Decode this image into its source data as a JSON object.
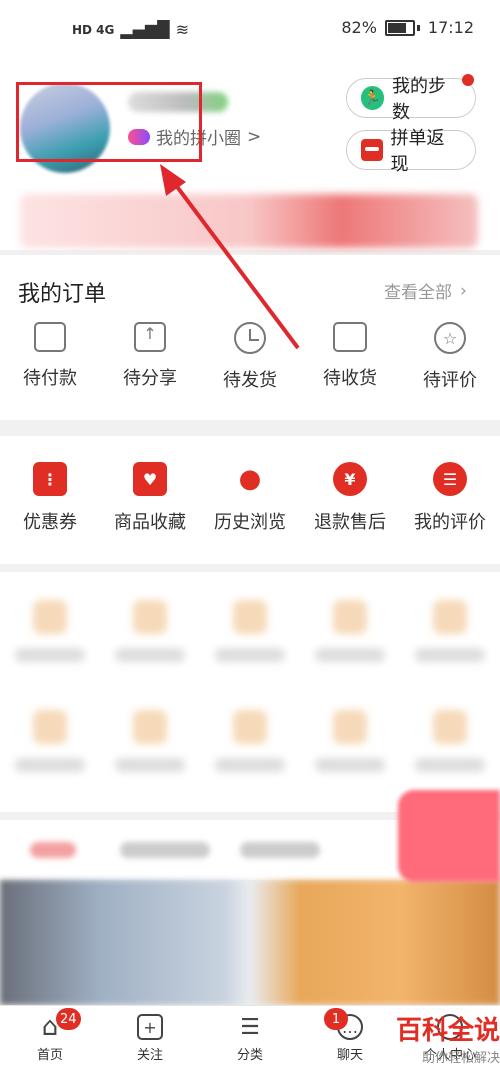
{
  "status_bar": {
    "left_icons": "HD 4G",
    "battery": "82%",
    "time": "17:12"
  },
  "profile": {
    "circle_link": "我的拼小圈",
    "chevron": ">"
  },
  "actions": {
    "steps": "我的步数",
    "cashback": "拼单返现"
  },
  "orders": {
    "title": "我的订单",
    "see_all": "查看全部",
    "items": [
      {
        "label": "待付款",
        "icon": "wallet-icon"
      },
      {
        "label": "待分享",
        "icon": "share-icon"
      },
      {
        "label": "待发货",
        "icon": "clock-icon"
      },
      {
        "label": "待收货",
        "icon": "truck-icon"
      },
      {
        "label": "待评价",
        "icon": "review-icon"
      }
    ]
  },
  "tools": {
    "items": [
      {
        "label": "优惠券",
        "icon": "coupon-icon",
        "glyph": "⋮"
      },
      {
        "label": "商品收藏",
        "icon": "bag-heart-icon",
        "glyph": "♥"
      },
      {
        "label": "历史浏览",
        "icon": "footprint-icon",
        "glyph": "●"
      },
      {
        "label": "退款售后",
        "icon": "yen-icon",
        "glyph": "¥"
      },
      {
        "label": "我的评价",
        "icon": "comment-list-icon",
        "glyph": "☰"
      }
    ]
  },
  "bottom_nav": {
    "items": [
      {
        "label": "首页",
        "icon": "home-icon",
        "glyph": "⌂",
        "badge": "24"
      },
      {
        "label": "关注",
        "icon": "plus-icon",
        "glyph": "+",
        "badge": ""
      },
      {
        "label": "分类",
        "icon": "menu-icon",
        "glyph": "☰",
        "badge": ""
      },
      {
        "label": "聊天",
        "icon": "chat-icon",
        "glyph": "…",
        "badge": "1"
      },
      {
        "label": "个人中心",
        "icon": "person-icon",
        "glyph": "",
        "badge": ""
      }
    ]
  },
  "watermark": {
    "title": "百科全说",
    "subtitle": "助你轻松解决"
  },
  "colors": {
    "accent": "#e02e24",
    "highlight": "#e0272d"
  }
}
